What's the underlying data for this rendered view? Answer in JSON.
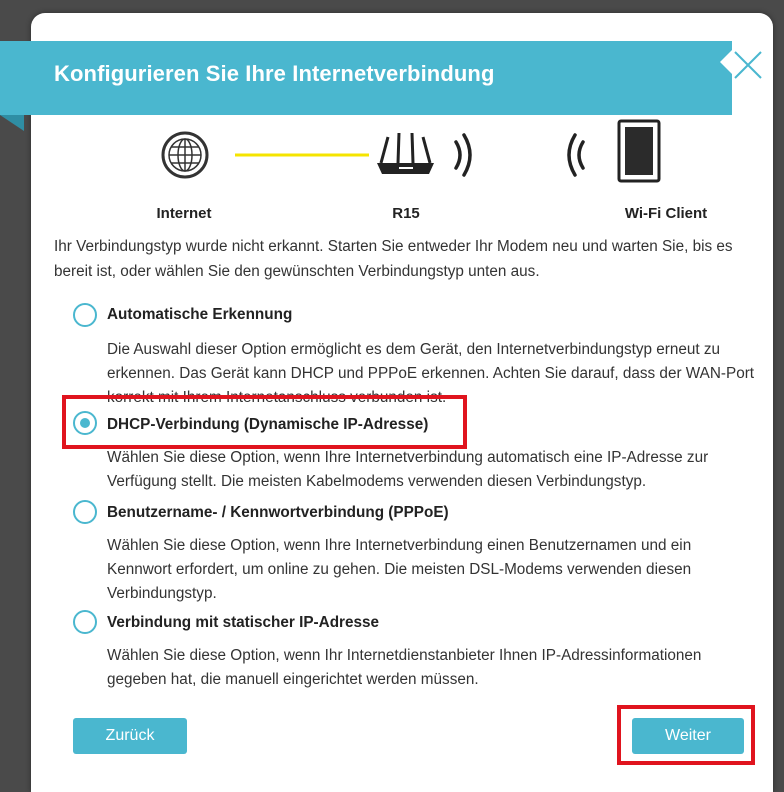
{
  "dialog": {
    "title": "Konfigurieren Sie Ihre Internetverbindung",
    "close_icon": "close-icon"
  },
  "diagram": {
    "internet_label": "Internet",
    "router_label": "R15",
    "client_label": "Wi-Fi Client",
    "link_color": "#f5e400"
  },
  "intro_text": "Ihr Verbindungstyp wurde nicht erkannt. Starten Sie entweder Ihr Modem neu und warten Sie, bis es bereit ist, oder wählen Sie den gewünschten Verbindungstyp unten aus.",
  "options": [
    {
      "title": "Automatische Erkennung",
      "description": "Die Auswahl dieser Option ermöglicht es dem Gerät, den Internetverbindungstyp erneut zu erkennen. Das Gerät kann DHCP und PPPoE erkennen. Achten Sie darauf, dass der WAN-Port korrekt mit Ihrem Internetanschluss verbunden ist.",
      "selected": false
    },
    {
      "title": "DHCP-Verbindung (Dynamische IP-Adresse)",
      "description": "Wählen Sie diese Option, wenn Ihre Internetverbindung automatisch eine IP-Adresse zur Verfügung stellt. Die meisten Kabelmodems verwenden diesen Verbindungstyp.",
      "selected": true
    },
    {
      "title": "Benutzername- / Kennwortverbindung (PPPoE)",
      "description": "Wählen Sie diese Option, wenn Ihre Internetverbindung einen Benutzernamen und ein Kennwort erfordert, um online zu gehen. Die meisten DSL-Modems verwenden diesen Verbindungstyp.",
      "selected": false
    },
    {
      "title": "Verbindung mit statischer IP-Adresse",
      "description": "Wählen Sie diese Option, wenn Ihr Internetdienstanbieter Ihnen IP-Adressinformationen gegeben hat, die manuell eingerichtet werden müssen.",
      "selected": false
    }
  ],
  "buttons": {
    "back_label": "Zurück",
    "next_label": "Weiter"
  },
  "colors": {
    "accent": "#4ab7cf",
    "highlight": "#e0141e"
  }
}
